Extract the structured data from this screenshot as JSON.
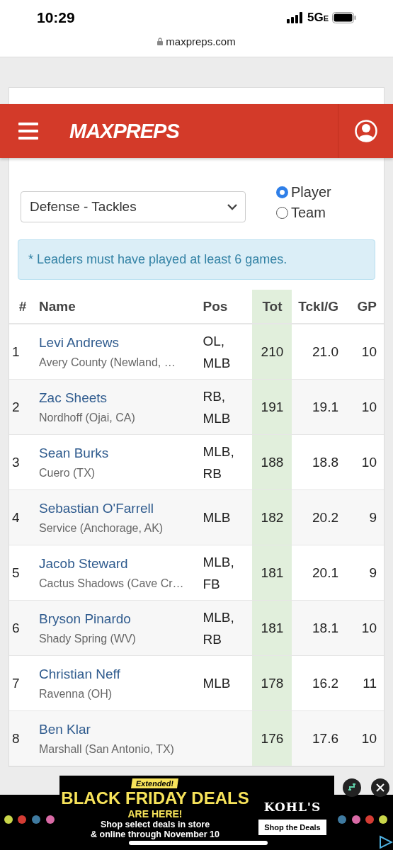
{
  "status_bar": {
    "time": "10:29",
    "network": "5G",
    "network_suffix": "E"
  },
  "address_bar": {
    "url": "maxpreps.com"
  },
  "header": {
    "logo": "MAXPREPS"
  },
  "stat_select": {
    "value": "Defense - Tackles"
  },
  "scope_options": [
    {
      "label": "Player",
      "selected": true
    },
    {
      "label": "Team",
      "selected": false
    }
  ],
  "notice": "* Leaders must have played at least 6 games.",
  "table": {
    "columns": [
      "#",
      "Name",
      "Pos",
      "Tot",
      "Tckl/G",
      "GP"
    ],
    "rows": [
      {
        "rank": "1",
        "name": "Levi Andrews",
        "school": "Avery County (Newland, …",
        "pos": [
          "OL,",
          "MLB"
        ],
        "tot": "210",
        "per_game": "21.0",
        "gp": "10"
      },
      {
        "rank": "2",
        "name": "Zac Sheets",
        "school": "Nordhoff (Ojai, CA)",
        "pos": [
          "RB,",
          "MLB"
        ],
        "tot": "191",
        "per_game": "19.1",
        "gp": "10"
      },
      {
        "rank": "3",
        "name": "Sean Burks",
        "school": "Cuero (TX)",
        "pos": [
          "MLB,",
          "RB"
        ],
        "tot": "188",
        "per_game": "18.8",
        "gp": "10"
      },
      {
        "rank": "4",
        "name": "Sebastian O'Farrell",
        "school": "Service (Anchorage, AK)",
        "pos": [
          "MLB"
        ],
        "tot": "182",
        "per_game": "20.2",
        "gp": "9"
      },
      {
        "rank": "5",
        "name": "Jacob Steward",
        "school": "Cactus Shadows (Cave Cr…",
        "pos": [
          "MLB,",
          "FB"
        ],
        "tot": "181",
        "per_game": "20.1",
        "gp": "9"
      },
      {
        "rank": "6",
        "name": "Bryson Pinardo",
        "school": "Shady Spring (WV)",
        "pos": [
          "MLB,",
          "RB"
        ],
        "tot": "181",
        "per_game": "18.1",
        "gp": "10"
      },
      {
        "rank": "7",
        "name": "Christian Neff",
        "school": "Ravenna (OH)",
        "pos": [
          "MLB"
        ],
        "tot": "178",
        "per_game": "16.2",
        "gp": "11"
      },
      {
        "rank": "8",
        "name": "Ben Klar",
        "school": "Marshall (San Antonio, TX)",
        "pos": [],
        "tot": "176",
        "per_game": "17.6",
        "gp": "10"
      }
    ]
  },
  "ad": {
    "badge": "Extended!",
    "headline": "BLACK FRIDAY DEALS",
    "subhead": "ARE HERE!",
    "body": [
      "Shop select deals in store",
      "& online through November 10"
    ],
    "brand": "KOHL'S",
    "cta": "Shop the Deals"
  }
}
